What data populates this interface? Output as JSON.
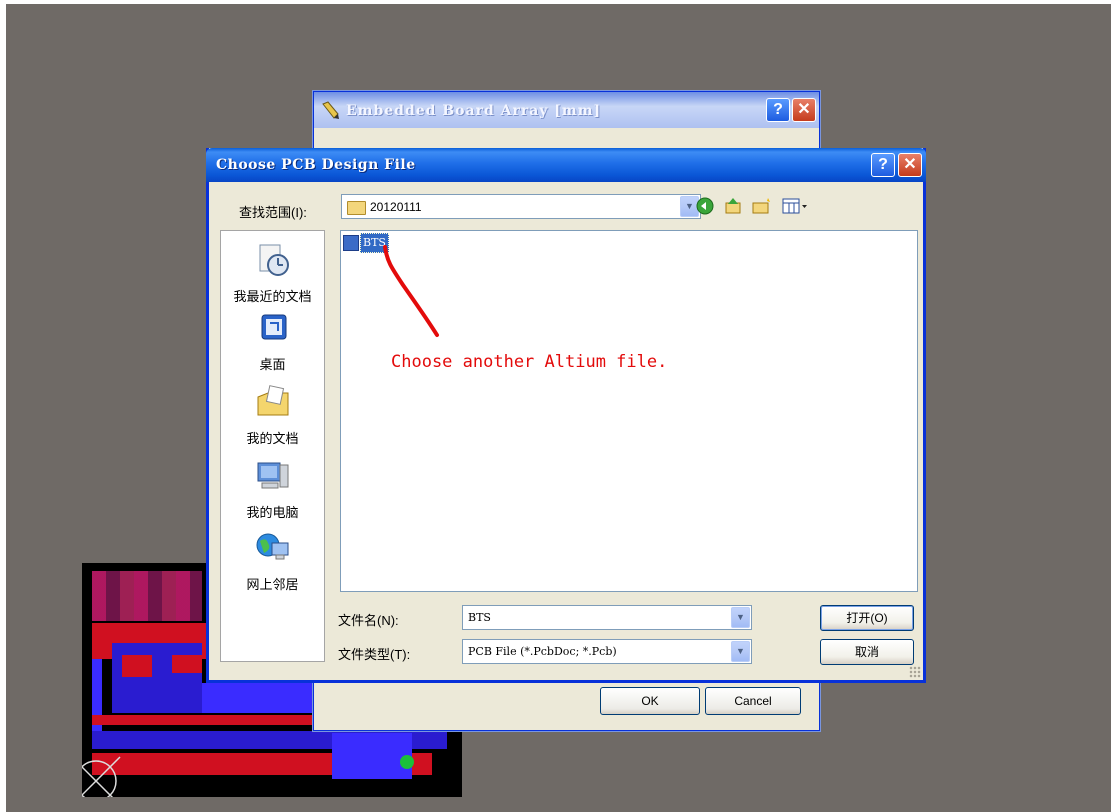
{
  "back_dialog": {
    "title": "Embedded Board Array [mm]",
    "ok_label": "OK",
    "cancel_label": "Cancel"
  },
  "dialog": {
    "title": "Choose PCB Design File",
    "help_glyph": "?",
    "close_glyph": "✕",
    "look_in_label": "查找范围(I):",
    "look_in_value": "20120111",
    "places": [
      {
        "label": "我最近的文档",
        "icon": "recent-documents-icon"
      },
      {
        "label": "桌面",
        "icon": "desktop-icon"
      },
      {
        "label": "我的文档",
        "icon": "my-documents-icon"
      },
      {
        "label": "我的电脑",
        "icon": "my-computer-icon"
      },
      {
        "label": "网上邻居",
        "icon": "network-places-icon"
      }
    ],
    "files": [
      {
        "name": "BTS",
        "selected": true
      }
    ],
    "annotation": "Choose another Altium file.",
    "file_name_label": "文件名(N):",
    "file_name_value": "BTS",
    "file_type_label": "文件类型(T):",
    "file_type_value": "PCB File (*.PcbDoc; *.Pcb)",
    "open_label": "打开(O)",
    "cancel_label": "取消"
  },
  "colors": {
    "titlebar": "#0a56d6",
    "dialog_face": "#ece9d8",
    "annotation": "#e30b0b",
    "selection": "#316ac5"
  }
}
